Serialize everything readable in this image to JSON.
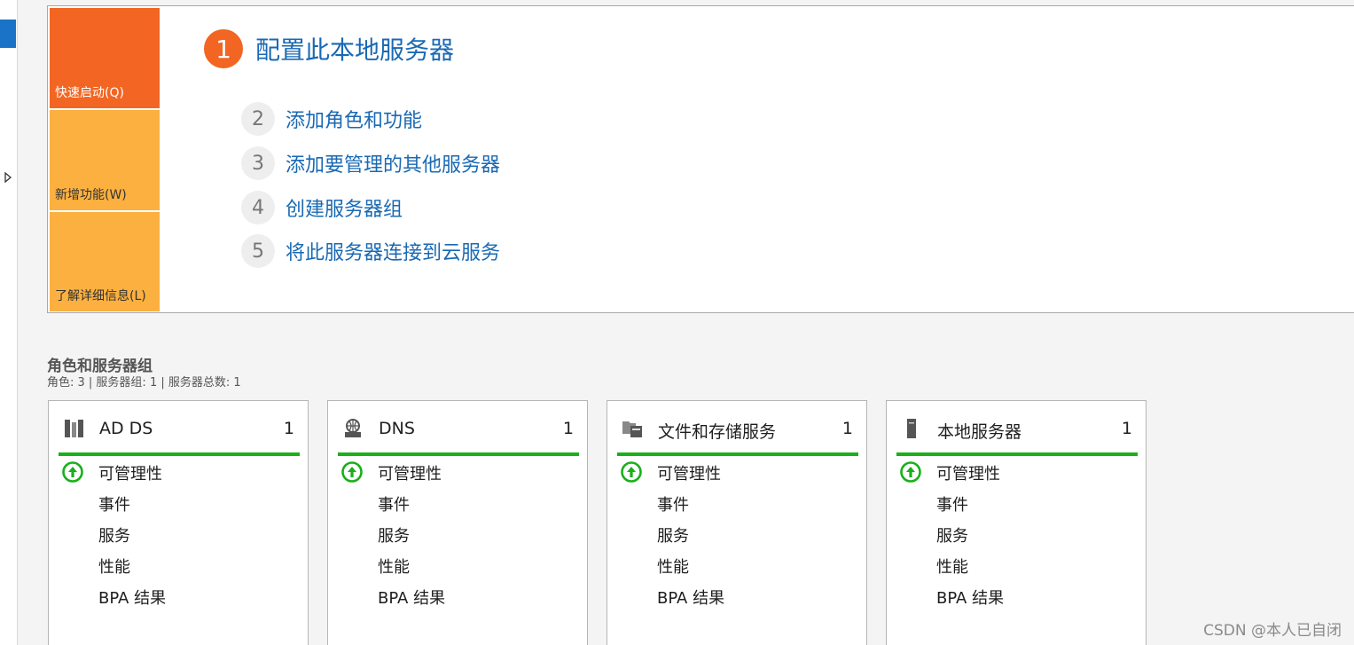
{
  "tiles": {
    "quick_start": "快速启动(Q)",
    "new_features": "新增功能(W)",
    "learn_more": "了解详细信息(L)"
  },
  "steps": [
    {
      "num": "1",
      "label": "配置此本地服务器"
    },
    {
      "num": "2",
      "label": "添加角色和功能"
    },
    {
      "num": "3",
      "label": "添加要管理的其他服务器"
    },
    {
      "num": "4",
      "label": "创建服务器组"
    },
    {
      "num": "5",
      "label": "将此服务器连接到云服务"
    }
  ],
  "roles": {
    "title": "角色和服务器组",
    "summary": "角色: 3 | 服务器组: 1 | 服务器总数: 1",
    "cards": [
      {
        "name": "AD DS",
        "count": "1",
        "icon": "ad-ds-icon",
        "rows": [
          "可管理性",
          "事件",
          "服务",
          "性能",
          "BPA 结果"
        ]
      },
      {
        "name": "DNS",
        "count": "1",
        "icon": "dns-icon",
        "rows": [
          "可管理性",
          "事件",
          "服务",
          "性能",
          "BPA 结果"
        ]
      },
      {
        "name": "文件和存储服务",
        "count": "1",
        "icon": "file-storage-icon",
        "rows": [
          "可管理性",
          "事件",
          "服务",
          "性能",
          "BPA 结果"
        ]
      },
      {
        "name": "本地服务器",
        "count": "1",
        "icon": "local-server-icon",
        "rows": [
          "可管理性",
          "事件",
          "服务",
          "性能",
          "BPA 结果"
        ]
      }
    ]
  },
  "watermark": "CSDN @本人已自闭",
  "colors": {
    "orange": "#f26522",
    "amber": "#fbb040",
    "link_blue": "#1a69b3",
    "status_green": "#19b019"
  }
}
